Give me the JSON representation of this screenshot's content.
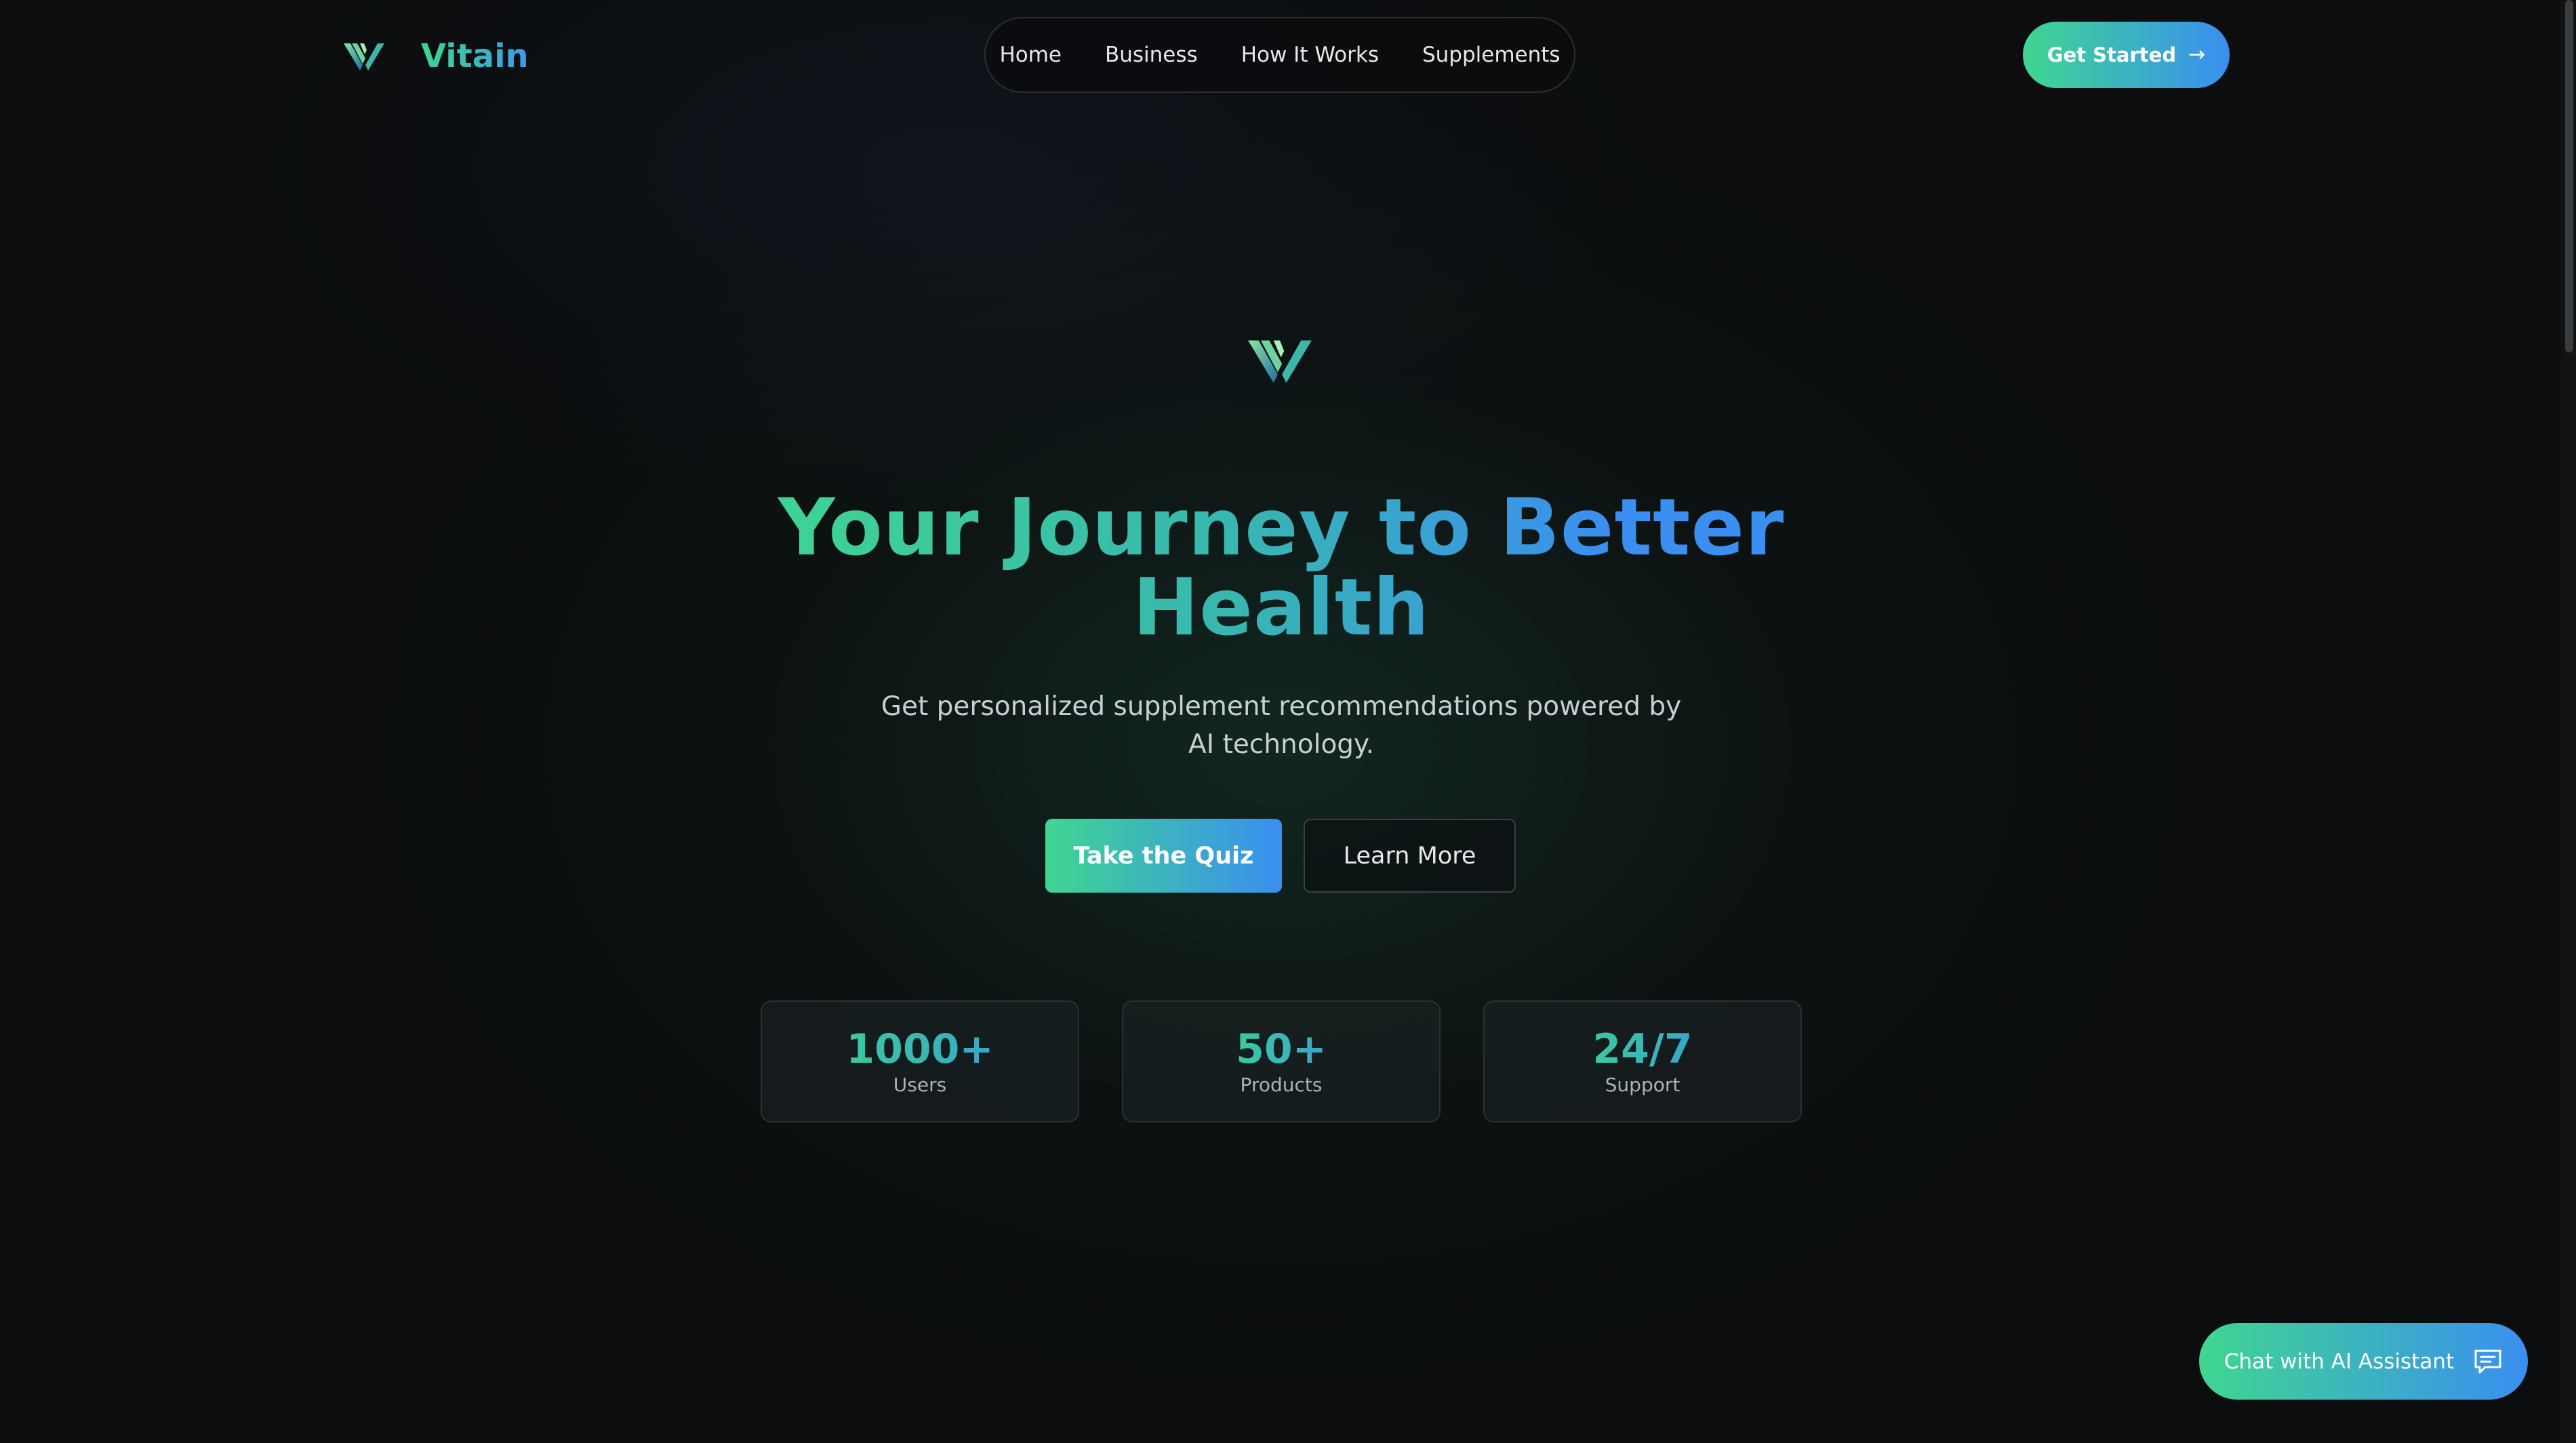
{
  "header": {
    "brand": "Vitain",
    "nav": [
      "Home",
      "Business",
      "How It Works",
      "Supplements"
    ],
    "cta_label": "Get Started",
    "cta_icon": "arrow-right-icon"
  },
  "hero": {
    "title_line1": "Your Journey to Better",
    "title_line2": "Health",
    "subtitle": "Get personalized supplement recommendations powered by AI technology.",
    "primary_button": "Take the Quiz",
    "secondary_button": "Learn More"
  },
  "stats": [
    {
      "value": "1000+",
      "label": "Users"
    },
    {
      "value": "50+",
      "label": "Products"
    },
    {
      "value": "24/7",
      "label": "Support"
    }
  ],
  "chat": {
    "label": "Chat with AI Assistant",
    "icon": "chat-bubble-icon"
  },
  "colors": {
    "gradient_start": "#3fd690",
    "gradient_end": "#3a8ff0",
    "background": "#0b0d0e"
  }
}
